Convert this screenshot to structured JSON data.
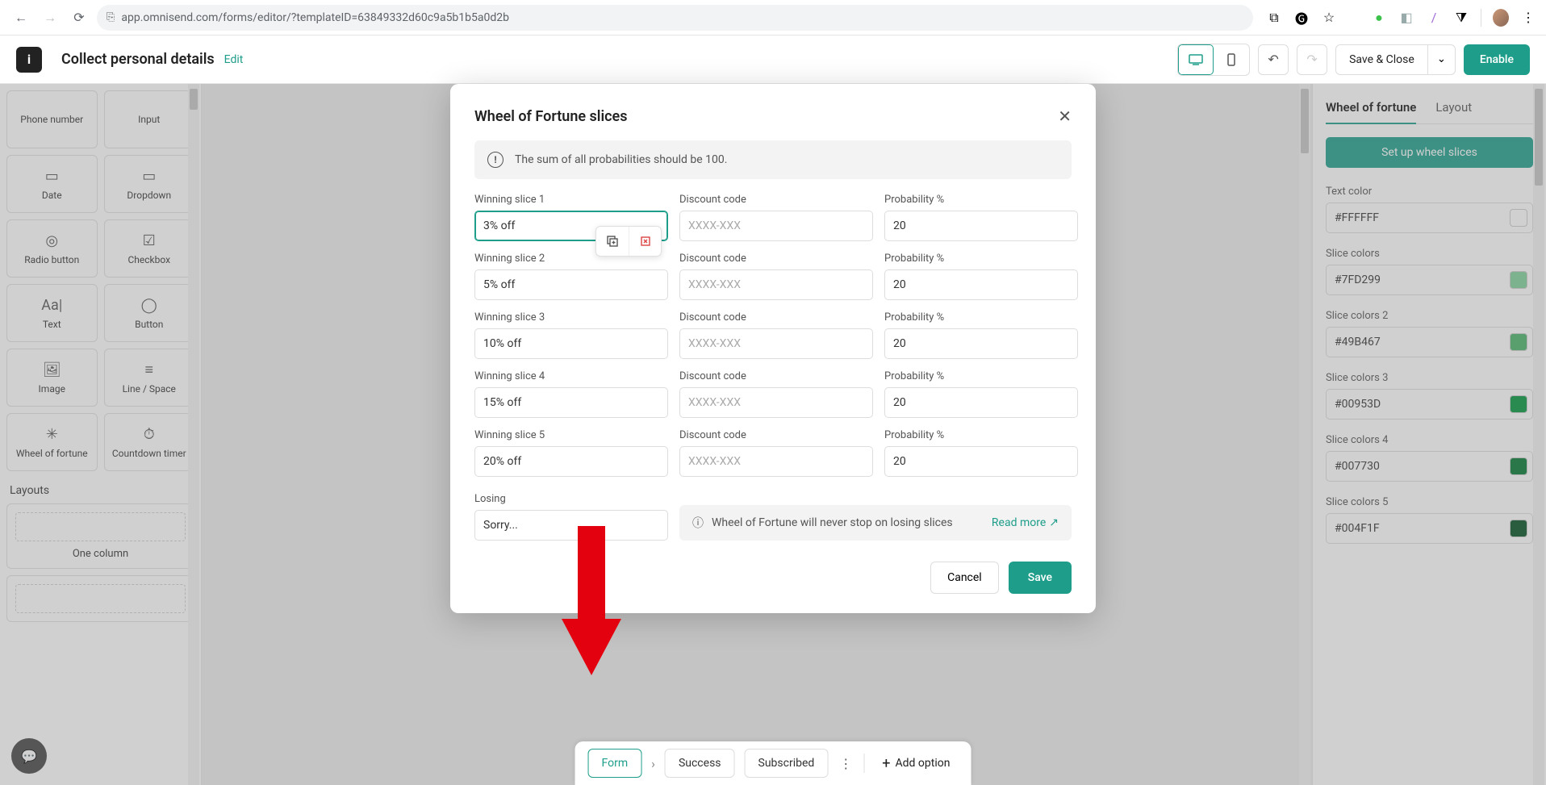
{
  "browser": {
    "url": "app.omnisend.com/forms/editor/?templateID=63849332d60c9a5b1b5a0d2b"
  },
  "header": {
    "page_title": "Collect personal details",
    "edit": "Edit",
    "save_close": "Save & Close",
    "enable": "Enable"
  },
  "palette": {
    "items": [
      {
        "label": "Phone number"
      },
      {
        "label": "Input"
      },
      {
        "label": "Date"
      },
      {
        "label": "Dropdown"
      },
      {
        "label": "Radio button"
      },
      {
        "label": "Checkbox"
      },
      {
        "label": "Text"
      },
      {
        "label": "Button"
      },
      {
        "label": "Image"
      },
      {
        "label": "Line / Space"
      },
      {
        "label": "Wheel of fortune"
      },
      {
        "label": "Countdown timer"
      }
    ],
    "layouts_title": "Layouts",
    "layout_one": "One column"
  },
  "steps": {
    "form": "Form",
    "success": "Success",
    "subscribed": "Subscribed",
    "add": "Add option"
  },
  "right": {
    "tab_wheel": "Wheel of fortune",
    "tab_layout": "Layout",
    "setup": "Set up wheel slices",
    "text_color_label": "Text color",
    "text_color_value": "#FFFFFF",
    "slice1_label": "Slice colors",
    "slice1_value": "#7FD299",
    "slice2_label": "Slice colors 2",
    "slice2_value": "#49B467",
    "slice3_label": "Slice colors 3",
    "slice3_value": "#00953D",
    "slice4_label": "Slice colors 4",
    "slice4_value": "#007730",
    "slice5_label": "Slice colors 5",
    "slice5_value": "#004F1F"
  },
  "modal": {
    "title": "Wheel of Fortune slices",
    "banner": "The sum of all probabilities should be 100.",
    "discount_label": "Discount code",
    "discount_ph": "XXXX-XXX",
    "prob_label": "Probability %",
    "slices": [
      {
        "label": "Winning slice 1",
        "value": "3% off",
        "prob": "20"
      },
      {
        "label": "Winning slice 2",
        "value": "5% off",
        "prob": "20"
      },
      {
        "label": "Winning slice 3",
        "value": "10% off",
        "prob": "20"
      },
      {
        "label": "Winning slice 4",
        "value": "15% off",
        "prob": "20"
      },
      {
        "label": "Winning slice 5",
        "value": "20% off",
        "prob": "20"
      }
    ],
    "losing_label": "Losing",
    "losing_value": "Sorry...",
    "losing_note": "Wheel of Fortune will never stop on losing slices",
    "read_more": "Read more",
    "cancel": "Cancel",
    "save": "Save"
  }
}
